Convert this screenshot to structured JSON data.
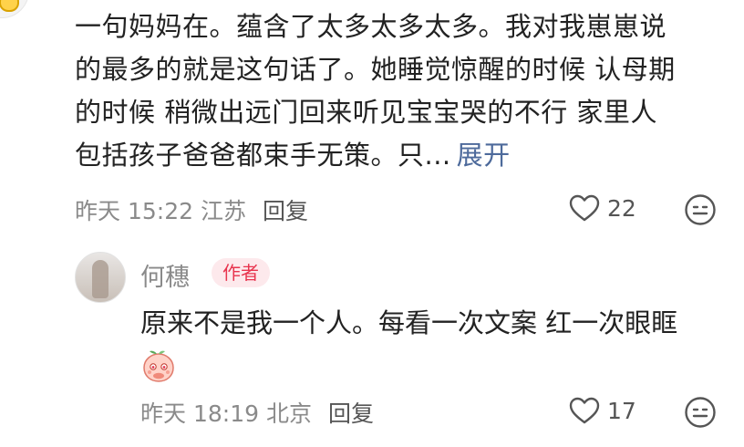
{
  "comment": {
    "lines": [
      "一句妈妈在。蕴含了太多太多太多。我对我崽崽说",
      "的最多的就是这句话了。她睡觉惊醒的时候 认母期",
      "的时候 稍微出远门回来听见宝宝哭的不行  家里人",
      "包括孩子爸爸都束手无策。只..."
    ],
    "expand_label": "展开",
    "date": "昨天",
    "time": "15:22",
    "location": "江苏",
    "reply_label": "回复",
    "likes": "22"
  },
  "reply": {
    "author": "何穗",
    "author_badge": "作者",
    "text": "原来不是我一个人。每看一次文案 红一次眼眶",
    "date": "昨天",
    "time": "18:19",
    "location": "北京",
    "reply_label": "回复",
    "likes": "17"
  },
  "colors": {
    "text": "#222222",
    "meta": "#8a8a8a",
    "link": "#4d6a9b",
    "badge_bg": "#fde9ec",
    "badge_text": "#e8344e"
  }
}
